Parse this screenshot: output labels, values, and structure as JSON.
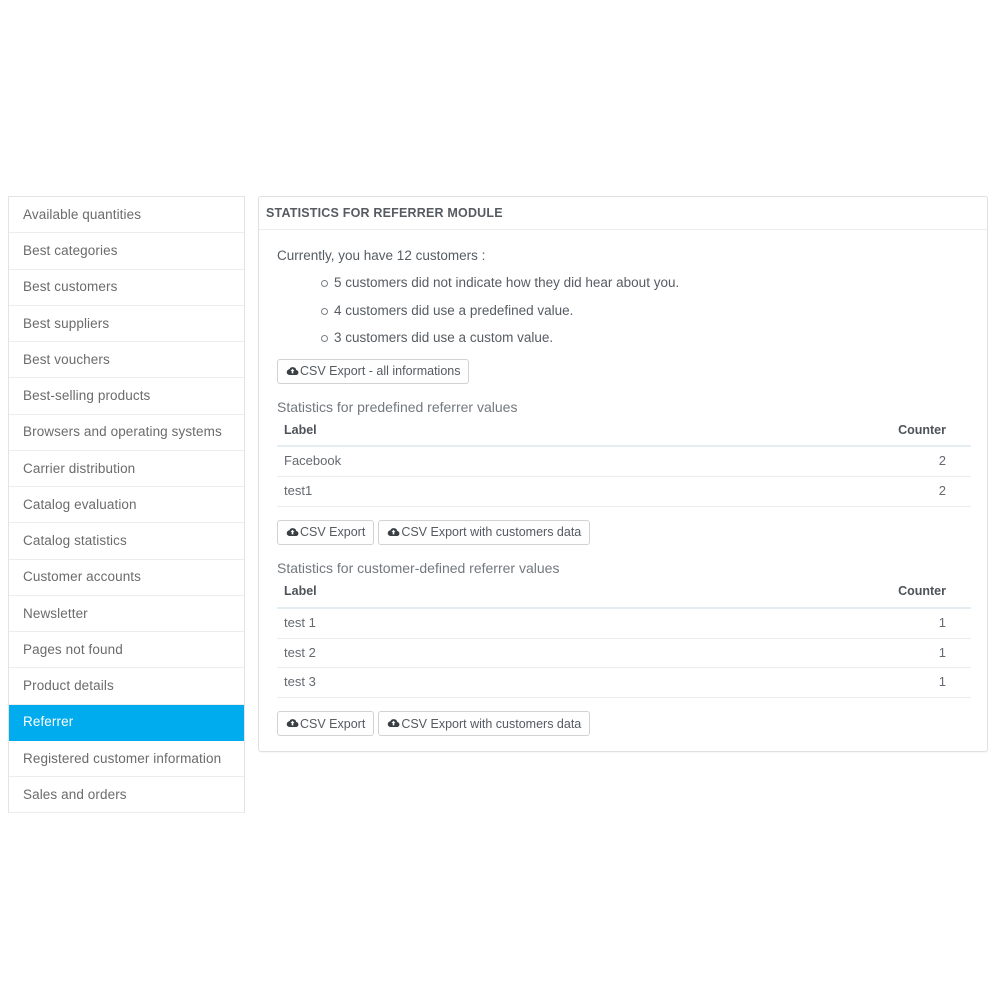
{
  "sidebar": {
    "items": [
      {
        "label": "Available quantities",
        "active": false
      },
      {
        "label": "Best categories",
        "active": false
      },
      {
        "label": "Best customers",
        "active": false
      },
      {
        "label": "Best suppliers",
        "active": false
      },
      {
        "label": "Best vouchers",
        "active": false
      },
      {
        "label": "Best-selling products",
        "active": false
      },
      {
        "label": "Browsers and operating systems",
        "active": false
      },
      {
        "label": "Carrier distribution",
        "active": false
      },
      {
        "label": "Catalog evaluation",
        "active": false
      },
      {
        "label": "Catalog statistics",
        "active": false
      },
      {
        "label": "Customer accounts",
        "active": false
      },
      {
        "label": "Newsletter",
        "active": false
      },
      {
        "label": "Pages not found",
        "active": false
      },
      {
        "label": "Product details",
        "active": false
      },
      {
        "label": "Referrer",
        "active": true
      },
      {
        "label": "Registered customer information",
        "active": false
      },
      {
        "label": "Sales and orders",
        "active": false
      }
    ]
  },
  "panel": {
    "title": "STATISTICS FOR REFERRER MODULE",
    "intro": "Currently, you have 12 customers :",
    "facts": [
      "5 customers did not indicate how they did hear about you.",
      "4 customers did use a predefined value.",
      "3 customers did use a custom value."
    ],
    "export_all_label": "CSV Export - all informations",
    "predefined": {
      "subhead": "Statistics for predefined referrer values",
      "columns": [
        "Label",
        "Counter"
      ],
      "rows": [
        {
          "label": "Facebook",
          "counter": "2"
        },
        {
          "label": "test1",
          "counter": "2"
        }
      ],
      "export_label": "CSV Export",
      "export_customers_label": "CSV Export with customers data"
    },
    "custom": {
      "subhead": "Statistics for customer-defined referrer values",
      "columns": [
        "Label",
        "Counter"
      ],
      "rows": [
        {
          "label": "test 1",
          "counter": "1"
        },
        {
          "label": "test 2",
          "counter": "1"
        },
        {
          "label": "test 3",
          "counter": "1"
        }
      ],
      "export_label": "CSV Export",
      "export_customers_label": "CSV Export with customers data"
    }
  },
  "colors": {
    "accent": "#00aced",
    "panel_border": "#e0e0e0",
    "row_border": "#ededed",
    "header_underline": "#e4eef2",
    "text": "#565c62"
  },
  "icons": {
    "export": "cloud-upload-icon"
  }
}
